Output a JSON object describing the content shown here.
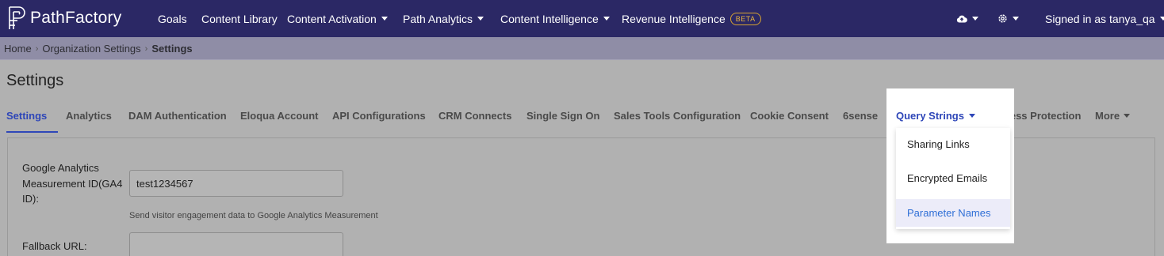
{
  "topnav": {
    "brand": "PathFactory",
    "items": [
      "Goals",
      "Content Library",
      "Content Activation",
      "Path Analytics",
      "Content Intelligence",
      "Revenue Intelligence"
    ],
    "beta_badge": "BETA",
    "user_label": "Signed in as tanya_qa"
  },
  "breadcrumb": {
    "items": [
      "Home",
      "Organization Settings",
      "Settings"
    ]
  },
  "page": {
    "title": "Settings",
    "tabs": [
      "Settings",
      "Analytics",
      "DAM Authentication",
      "Eloqua Account",
      "API Configurations",
      "CRM Connects",
      "Single Sign On",
      "Sales Tools Configuration",
      "Cookie Consent",
      "6sense",
      "Query Strings",
      "Access Protection",
      "More"
    ]
  },
  "form": {
    "ga_label": "Google Analytics Measurement ID(GA4 ID):",
    "ga_value": "test1234567",
    "ga_help": "Send visitor engagement data to Google Analytics Measurement",
    "fallback_label": "Fallback URL:",
    "fallback_value": ""
  },
  "dropdown": {
    "title": "Query Strings",
    "items": [
      "Sharing Links",
      "Encrypted Emails",
      "Parameter Names"
    ],
    "selected": "Parameter Names"
  },
  "colors": {
    "nav_bg": "#2b2865",
    "active_tab": "#2e46b8",
    "beta": "#e8b43f",
    "selected_item": "#2f6fd6"
  }
}
